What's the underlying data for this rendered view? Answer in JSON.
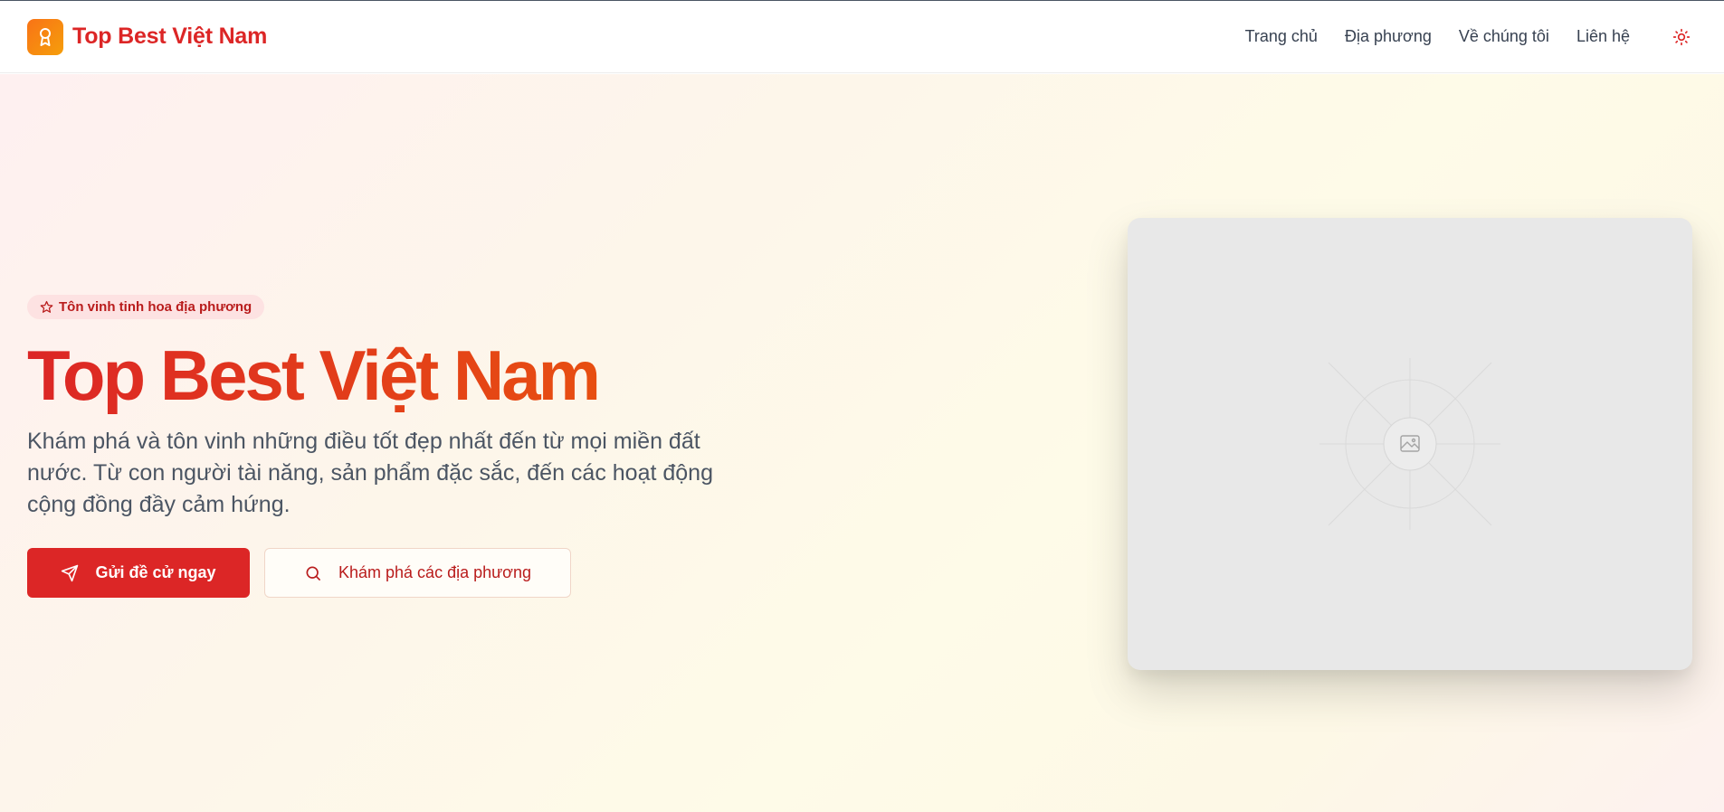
{
  "brand": {
    "name": "Top Best Việt Nam",
    "logo_icon": "award-ribbon-icon",
    "accent": "#dc2626",
    "logo_gradient": [
      "#f97316",
      "#f59e0b"
    ]
  },
  "nav": {
    "items": [
      {
        "label": "Trang chủ"
      },
      {
        "label": "Địa phương"
      },
      {
        "label": "Về chúng tôi"
      },
      {
        "label": "Liên hệ"
      }
    ],
    "theme_toggle_icon": "sun-icon"
  },
  "hero": {
    "badge": {
      "icon": "star-icon",
      "text": "Tôn vinh tinh hoa địa phương"
    },
    "title": "Top Best Việt Nam",
    "title_gradient": [
      "#dc2626",
      "#ea580c"
    ],
    "description": "Khám phá và tôn vinh những điều tốt đẹp nhất đến từ mọi miền đất nước. Từ con người tài năng, sản phẩm đặc sắc, đến các hoạt động cộng đồng đầy cảm hứng.",
    "primary_button": {
      "label": "Gửi đề cử ngay",
      "icon": "send-icon"
    },
    "secondary_button": {
      "label": "Khám phá các địa phương",
      "icon": "search-icon"
    },
    "image": {
      "icon": "image-placeholder-icon"
    }
  }
}
